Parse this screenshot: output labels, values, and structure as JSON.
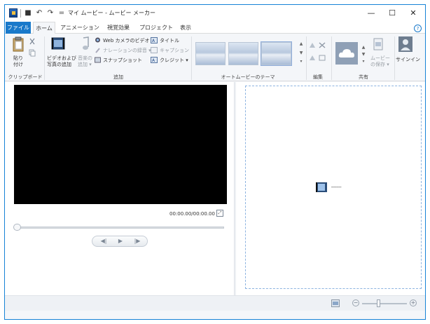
{
  "window": {
    "title": "マイ ムービー - ムービー メーカー",
    "minimize_glyph": "—",
    "maximize_glyph": "☐",
    "close_glyph": "✕"
  },
  "quick_access": {
    "save_glyph": "■",
    "undo_glyph": "↶",
    "redo_glyph": "↷",
    "customize_glyph": "="
  },
  "tabs": [
    {
      "label": "ファイル"
    },
    {
      "label": "ホーム"
    },
    {
      "label": "アニメーション"
    },
    {
      "label": "視覚効果"
    },
    {
      "label": "プロジェクト"
    },
    {
      "label": "表示"
    }
  ],
  "ribbon": {
    "clipboard": {
      "paste_label_1": "貼り",
      "paste_label_2": "付け",
      "group": "クリップボード"
    },
    "add": {
      "add_video_1": "ビデオおよび",
      "add_video_2": "写真の追加",
      "add_music_1": "音楽の",
      "add_music_2": "追加 ▾",
      "webcam": "Web カメラのビデオ",
      "narration": "ナレーションの録音 ▾",
      "snapshot": "スナップショット",
      "title": "タイトル",
      "caption": "キャプション",
      "credits": "クレジット ▾",
      "group": "追加"
    },
    "themes": {
      "group": "オートムービーのテーマ"
    },
    "edit": {
      "group": "編集"
    },
    "share": {
      "save_movie_1": "ムービー",
      "save_movie_2": "の保存 ▾",
      "group": "共有"
    },
    "signin": {
      "label": "サインイン"
    }
  },
  "player": {
    "timecode": "00:00.00/00:00.00",
    "prev_frame": "◀|",
    "play": "▶",
    "next_frame": "|▶"
  },
  "storyboard": {
    "hint": "━━━━━━━━"
  },
  "statusbar": {
    "zoom_out": "−",
    "zoom_in": "+"
  }
}
